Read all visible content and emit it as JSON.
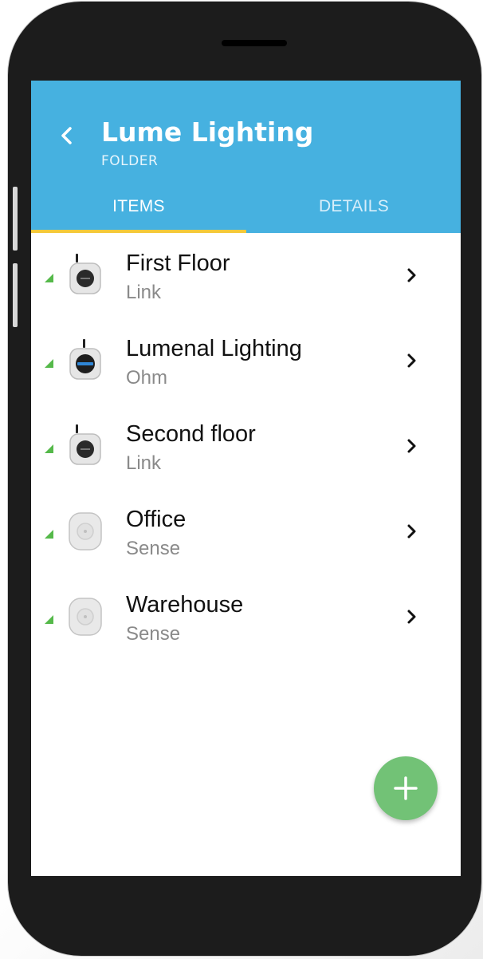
{
  "header": {
    "title": "Lume Lighting",
    "subtitle": "FOLDER"
  },
  "tabs": [
    {
      "label": "ITEMS",
      "selected": true
    },
    {
      "label": "DETAILS",
      "selected": false
    }
  ],
  "items": [
    {
      "name": "First Floor",
      "type": "Link",
      "icon": "link-hub-icon"
    },
    {
      "name": "Lumenal Lighting",
      "type": "Ohm",
      "icon": "ohm-device-icon"
    },
    {
      "name": "Second floor",
      "type": "Link",
      "icon": "link-hub-icon"
    },
    {
      "name": "Office",
      "type": "Sense",
      "icon": "sense-sensor-icon"
    },
    {
      "name": "Warehouse",
      "type": "Sense",
      "icon": "sense-sensor-icon"
    }
  ],
  "colors": {
    "appbar": "#46b1e0",
    "tab_indicator": "#f4c93a",
    "signal": "#55b94a",
    "fab": "#72c276"
  }
}
